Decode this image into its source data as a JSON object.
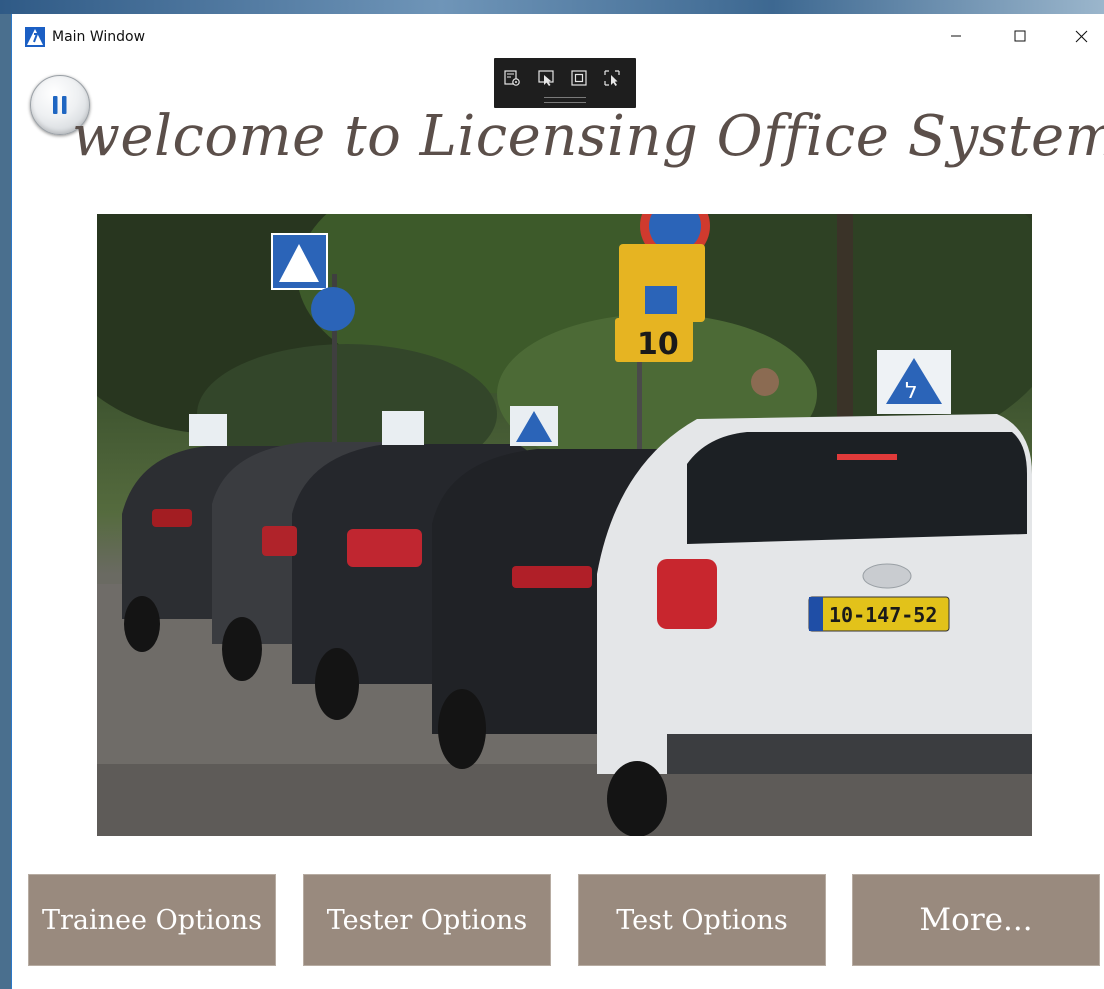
{
  "window": {
    "title": "Main Window"
  },
  "page": {
    "heading": "welcome to Licensing Office System!"
  },
  "buttons": {
    "trainee": "Trainee Options",
    "tester": "Tester Options",
    "test": "Test Options",
    "more": "More..."
  },
  "hero_image": {
    "plate_text": "10-147-52",
    "sign_number": "10",
    "student_sign_letter": "ל"
  },
  "colors": {
    "button_bg": "#998a7e",
    "title_text": "#5b4f4a",
    "window_border": "#2b78c8",
    "toolbar_bg": "#1e1e1e"
  },
  "icons": {
    "app": "app-logo-icon",
    "minimize": "minimize-icon",
    "maximize": "maximize-icon",
    "close": "close-icon",
    "pause": "pause-icon"
  }
}
